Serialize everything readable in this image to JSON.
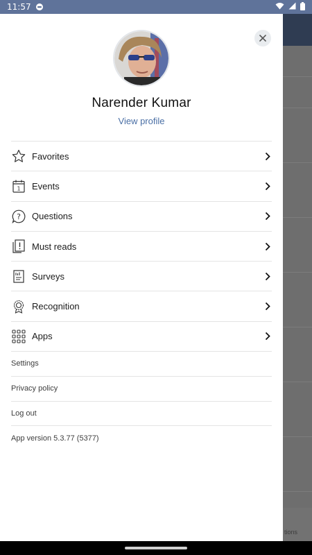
{
  "status_bar": {
    "time": "11:57",
    "icons": [
      "notification-icon",
      "wifi-icon",
      "signal-icon",
      "battery-icon"
    ]
  },
  "background_app": {
    "partial_tab_label": "tions"
  },
  "profile": {
    "name": "Narender Kumar",
    "view_profile_label": "View profile"
  },
  "menu": {
    "items": [
      {
        "label": "Favorites",
        "icon": "star-icon"
      },
      {
        "label": "Events",
        "icon": "calendar-icon"
      },
      {
        "label": "Questions",
        "icon": "question-icon"
      },
      {
        "label": "Must reads",
        "icon": "must-read-icon"
      },
      {
        "label": "Surveys",
        "icon": "survey-icon"
      },
      {
        "label": "Recognition",
        "icon": "award-icon"
      },
      {
        "label": "Apps",
        "icon": "apps-grid-icon"
      }
    ]
  },
  "links": {
    "settings": "Settings",
    "privacy": "Privacy policy",
    "logout": "Log out"
  },
  "app_version": "App version 5.3.77 (5377)",
  "colors": {
    "status_bar": "#5f739a",
    "accent_link": "#4a6fa5",
    "bg_header": "#2f3c52"
  }
}
